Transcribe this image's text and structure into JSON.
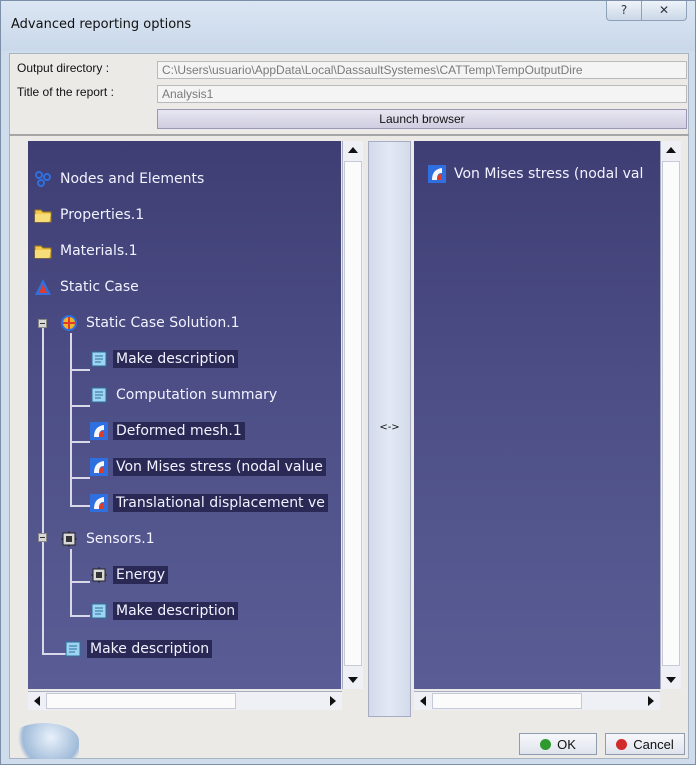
{
  "window": {
    "title": "Advanced reporting options",
    "help_glyph": "?",
    "close_glyph": "✕"
  },
  "form": {
    "output_dir_label": "Output directory :",
    "output_dir_value": "C:\\Users\\usuario\\AppData\\Local\\DassaultSystemes\\CATTemp\\TempOutputDire",
    "title_label": "Title of the report :",
    "title_value": "Analysis1",
    "launch_label": "Launch browser"
  },
  "swap_label": "<->",
  "left_tree": [
    {
      "label": "Nodes and Elements",
      "icon": "nodes-icon"
    },
    {
      "label": "Properties.1",
      "icon": "folder-icon"
    },
    {
      "label": "Materials.1",
      "icon": "folder-icon"
    },
    {
      "label": "Static Case",
      "icon": "static-case-icon"
    },
    {
      "label": "Static Case Solution.1",
      "icon": "solution-icon"
    },
    {
      "label": "Make description",
      "icon": "description-icon"
    },
    {
      "label": "Computation summary",
      "icon": "description-icon"
    },
    {
      "label": "Deformed mesh.1",
      "icon": "image-icon"
    },
    {
      "label": "Von Mises stress (nodal value",
      "icon": "image-icon"
    },
    {
      "label": "Translational displacement ve",
      "icon": "image-icon"
    },
    {
      "label": "Sensors.1",
      "icon": "sensor-icon"
    },
    {
      "label": "Energy",
      "icon": "sensor-icon"
    },
    {
      "label": "Make description",
      "icon": "description-icon"
    },
    {
      "label": "Make description",
      "icon": "description-icon"
    }
  ],
  "right_list": [
    {
      "label": "Von Mises stress (nodal val",
      "icon": "image-icon"
    }
  ],
  "buttons": {
    "ok": "OK",
    "cancel": "Cancel"
  },
  "colors": {
    "pane_bg": "#4a4b82",
    "ok_dot": "#2e9a2e",
    "cancel_dot": "#d02a2a"
  }
}
